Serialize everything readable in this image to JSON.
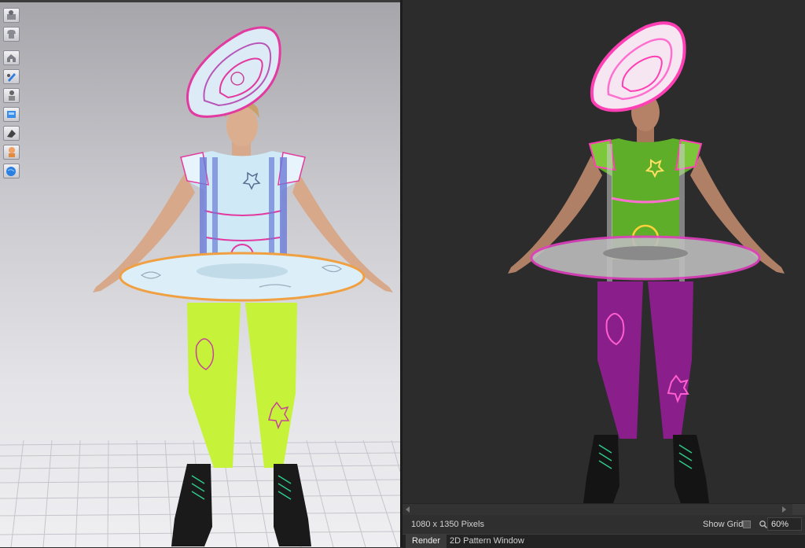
{
  "render_view": {
    "pixel_size": "1080 x 1350 Pixels",
    "show_grid_label": "Show Grid",
    "show_grid_checked": false,
    "zoom_value": "60%"
  },
  "tabs": [
    {
      "label": "Render",
      "active": true
    },
    {
      "label": "2D Pattern Window",
      "active": false
    }
  ],
  "toolbar_icons": [
    "avatar-display-icon",
    "garment-display-icon",
    "texture-icon",
    "pen-tool-icon",
    "avatar-visibility-icon",
    "surface-icon",
    "shading-icon",
    "skin-icon",
    "globe-icon"
  ],
  "colors": {
    "viewport_bg_top": "#a6a5aa",
    "viewport_bg_bottom": "#efeff2",
    "render_bg": "#2c2c2c",
    "leggings_left": "#c6f23a",
    "top_left": "#cfe9f6",
    "top_right": "#5fae2a",
    "leggings_right": "#8a1e8a",
    "neon_pink": "#ff3fb4"
  }
}
